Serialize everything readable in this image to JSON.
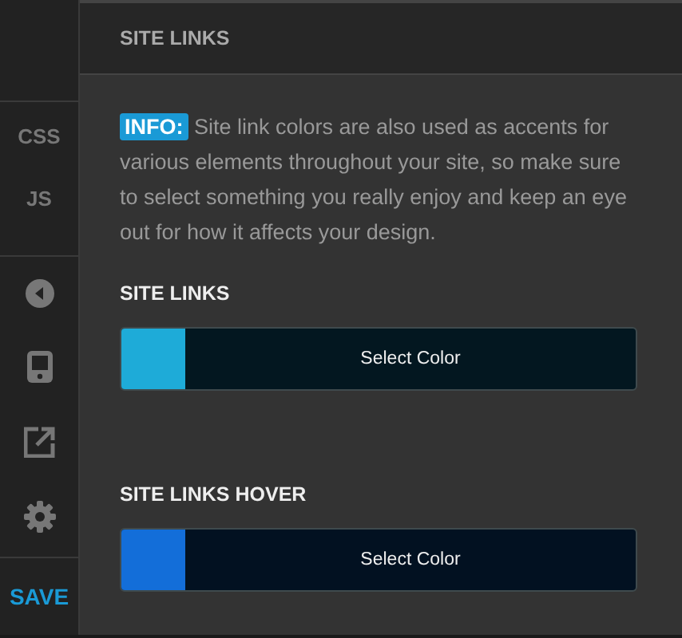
{
  "sidebar": {
    "items": [
      {
        "kind": "text",
        "label": "CSS"
      },
      {
        "kind": "text",
        "label": "JS"
      },
      {
        "kind": "back"
      },
      {
        "kind": "device"
      },
      {
        "kind": "external"
      },
      {
        "kind": "settings"
      }
    ],
    "save_button": "SAVE"
  },
  "panel": {
    "title": "SITE LINKS",
    "info_text": "**INFO:** Site link colors are also used as accents for various elements throughout your site, so make sure to select something you really enjoy and keep an eye out for how it affects your design.",
    "pickers": [
      {
        "label": "SITE LINKS",
        "button": "Select Color",
        "color": "#1eabd8"
      },
      {
        "label": "SITE LINKS HOVER",
        "button": "Select Color",
        "color": "#136ed9"
      }
    ]
  }
}
